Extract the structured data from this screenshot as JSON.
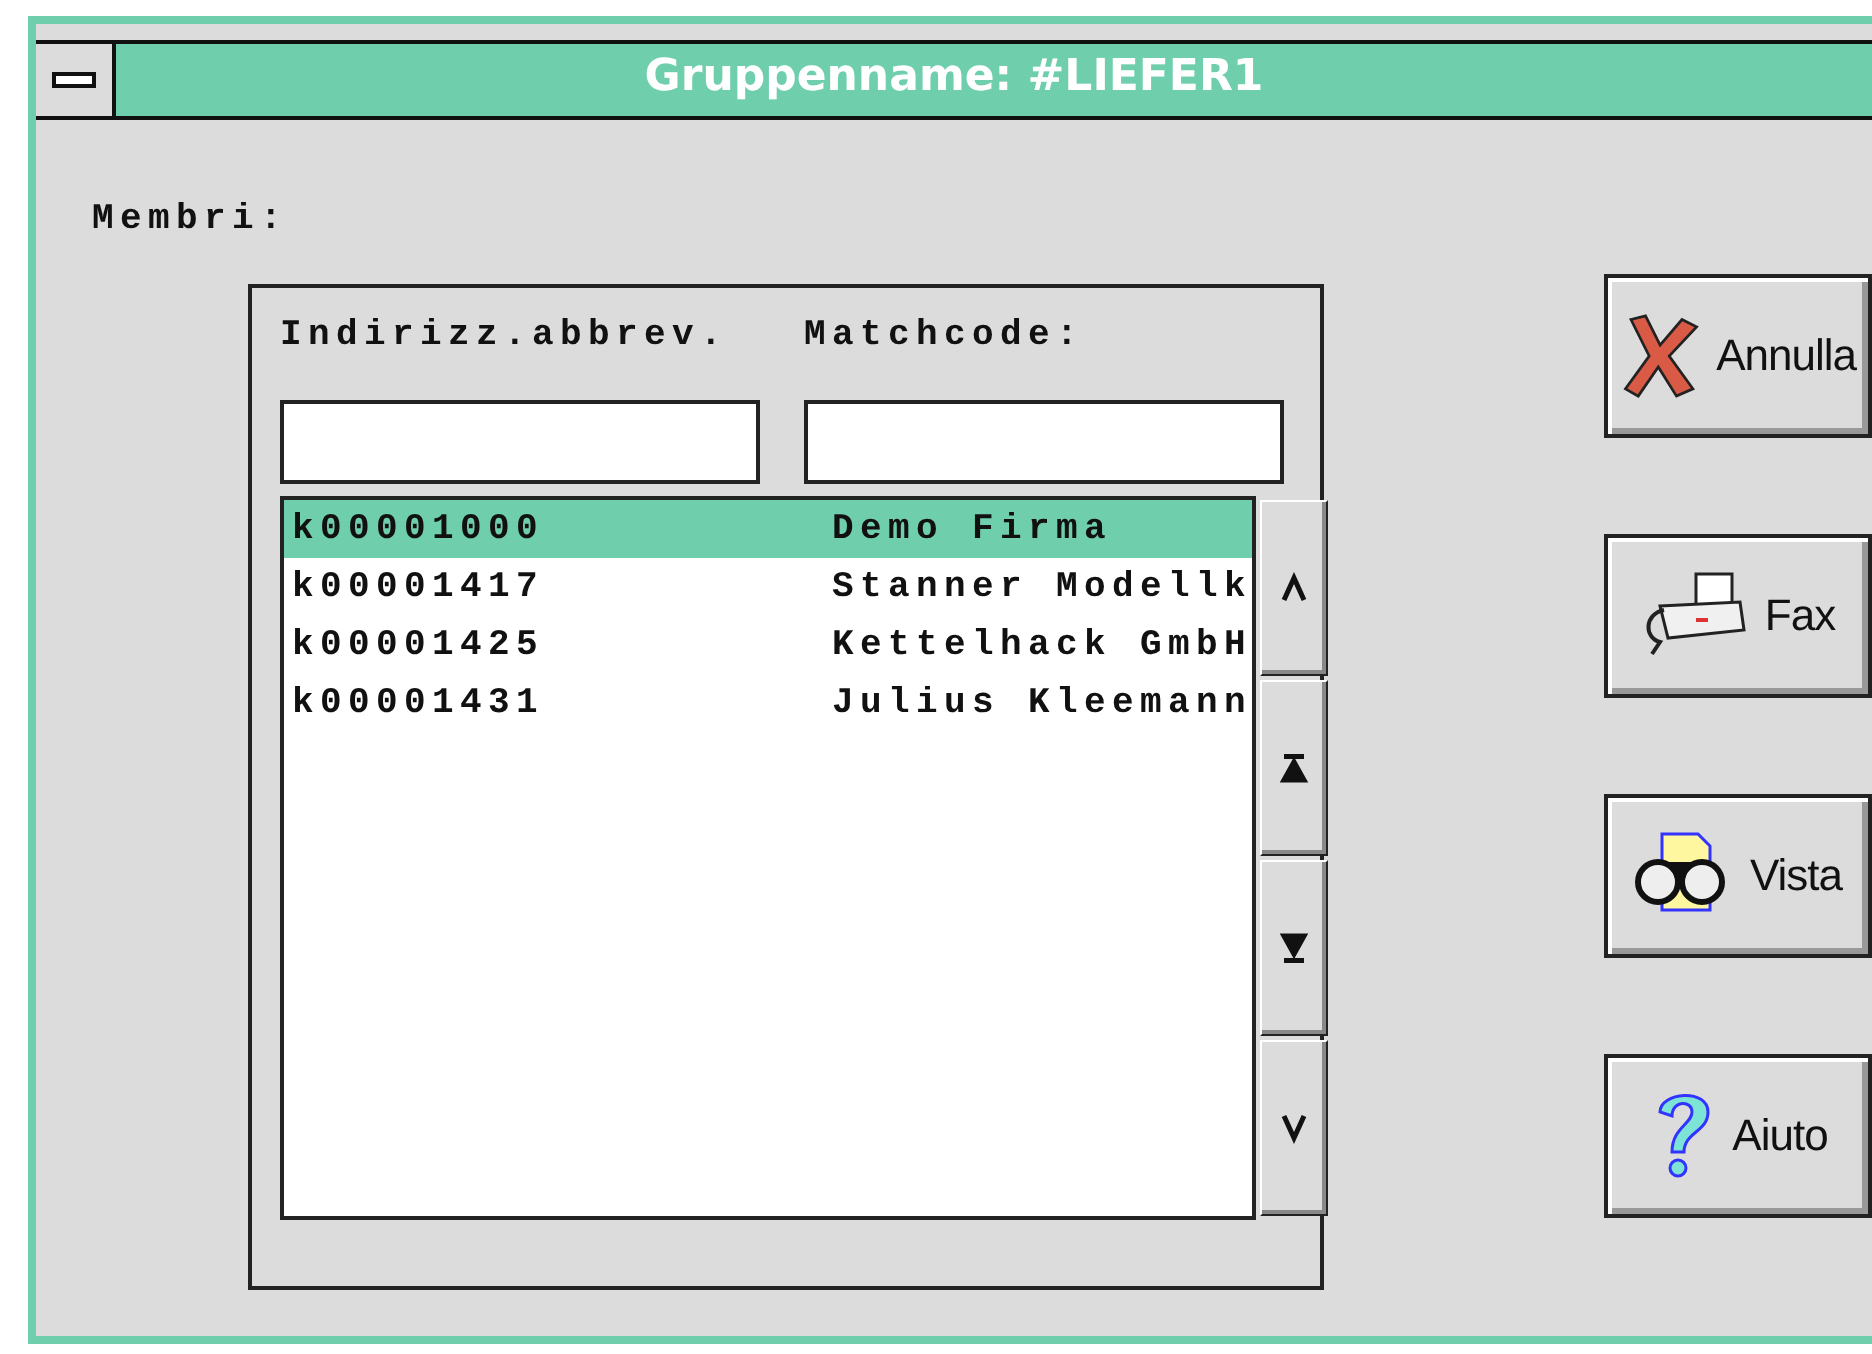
{
  "window": {
    "title": "Gruppenname: #LIEFER1"
  },
  "members_label": "Membri:",
  "columns": [
    "Indirizz.abbrev.",
    "Matchcode:"
  ],
  "rows": [
    {
      "code": "k00001000",
      "name": "Demo Firma",
      "selected": true
    },
    {
      "code": "k00001417",
      "name": "Stanner Modellk",
      "selected": false
    },
    {
      "code": "k00001425",
      "name": "Kettelhack GmbH",
      "selected": false
    },
    {
      "code": "k00001431",
      "name": "Julius Kleemann",
      "selected": false
    }
  ],
  "buttons": [
    {
      "label": "Annulla",
      "kind": "cancel"
    },
    {
      "label": "Fax",
      "kind": "fax"
    },
    {
      "label": "Vista",
      "kind": "view"
    },
    {
      "label": "Aiuto",
      "kind": "help"
    }
  ]
}
